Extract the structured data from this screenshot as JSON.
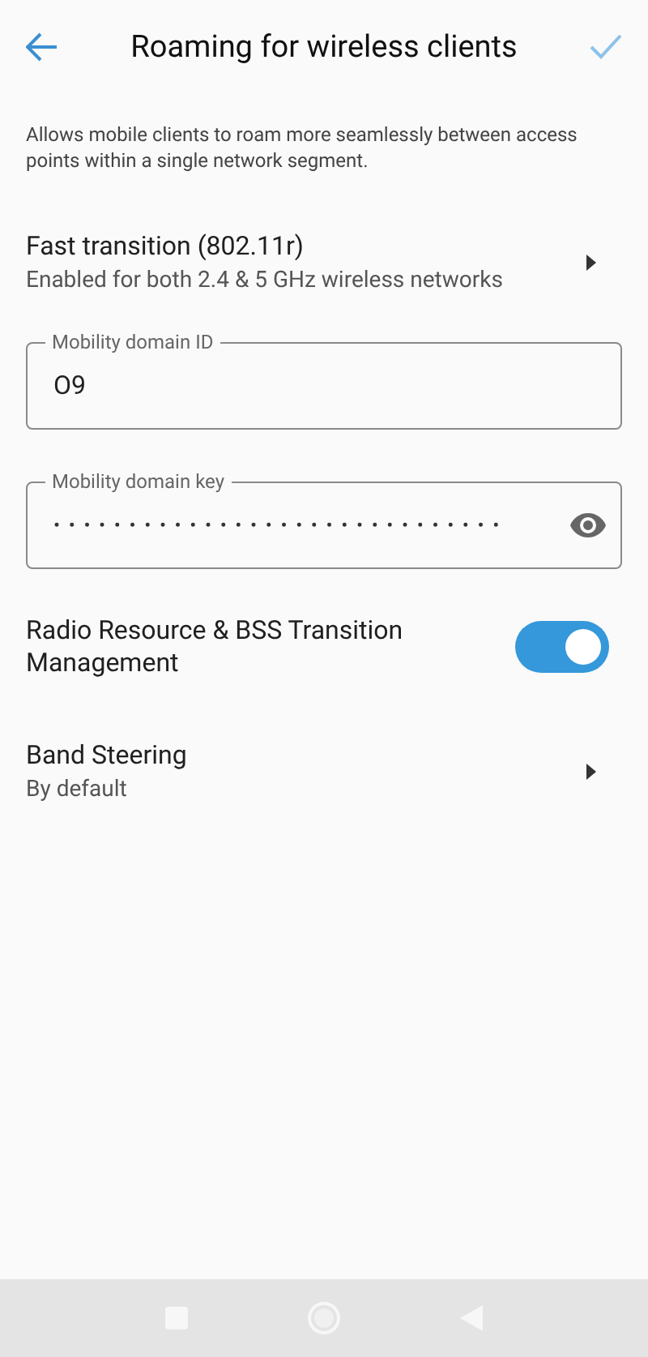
{
  "header": {
    "title": "Roaming for wireless clients"
  },
  "description": "Allows mobile clients to roam more seamlessly between access points within a single network segment.",
  "items": [
    {
      "kind": "link",
      "title": "Fast transition (802.11r)",
      "subtitle": "Enabled for both 2.4 & 5 GHz wireless networks"
    },
    {
      "kind": "field",
      "label": "Mobility domain ID",
      "value": "O9"
    },
    {
      "kind": "secret",
      "label": "Mobility domain key",
      "value": "••••••••••••••••••••••••••••••"
    },
    {
      "kind": "toggle",
      "title": "Radio Resource & BSS Transition Management",
      "on": true
    },
    {
      "kind": "link",
      "title": "Band Steering",
      "subtitle": "By default"
    }
  ]
}
